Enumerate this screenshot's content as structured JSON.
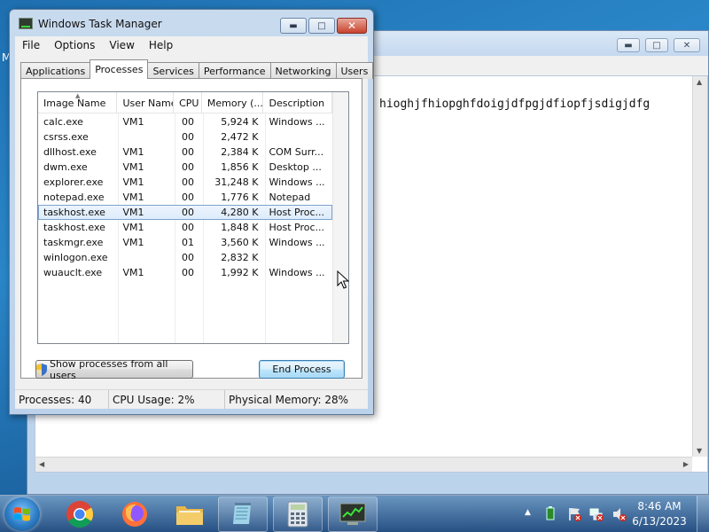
{
  "desktop": {
    "edge_letter": "M"
  },
  "notepad": {
    "text": "hioghjfhiopghfdoigjdfpgjdfiopfjsdigjdfg"
  },
  "taskmanager": {
    "title": "Windows Task Manager",
    "menu": [
      "File",
      "Options",
      "View",
      "Help"
    ],
    "tabs": [
      "Applications",
      "Processes",
      "Services",
      "Performance",
      "Networking",
      "Users"
    ],
    "active_tab": "Processes",
    "columns": [
      "Image Name",
      "User Name",
      "CPU",
      "Memory (...",
      "Description"
    ],
    "processes": [
      {
        "image": "calc.exe",
        "user": "VM1",
        "cpu": "00",
        "memory": "5,924 K",
        "desc": "Windows ..."
      },
      {
        "image": "csrss.exe",
        "user": "",
        "cpu": "00",
        "memory": "2,472 K",
        "desc": ""
      },
      {
        "image": "dllhost.exe",
        "user": "VM1",
        "cpu": "00",
        "memory": "2,384 K",
        "desc": "COM Surr..."
      },
      {
        "image": "dwm.exe",
        "user": "VM1",
        "cpu": "00",
        "memory": "1,856 K",
        "desc": "Desktop ..."
      },
      {
        "image": "explorer.exe",
        "user": "VM1",
        "cpu": "00",
        "memory": "31,248 K",
        "desc": "Windows ..."
      },
      {
        "image": "notepad.exe",
        "user": "VM1",
        "cpu": "00",
        "memory": "1,776 K",
        "desc": "Notepad"
      },
      {
        "image": "taskhost.exe",
        "user": "VM1",
        "cpu": "00",
        "memory": "4,280 K",
        "desc": "Host Proc..."
      },
      {
        "image": "taskhost.exe",
        "user": "VM1",
        "cpu": "00",
        "memory": "1,848 K",
        "desc": "Host Proc..."
      },
      {
        "image": "taskmgr.exe",
        "user": "VM1",
        "cpu": "01",
        "memory": "3,560 K",
        "desc": "Windows ..."
      },
      {
        "image": "winlogon.exe",
        "user": "",
        "cpu": "00",
        "memory": "2,832 K",
        "desc": ""
      },
      {
        "image": "wuauclt.exe",
        "user": "VM1",
        "cpu": "00",
        "memory": "1,992 K",
        "desc": "Windows ..."
      }
    ],
    "selected_row": 6,
    "show_all_label": "Show processes from all users",
    "end_process_label": "End Process",
    "status": {
      "processes": "Processes: 40",
      "cpu": "CPU Usage: 2%",
      "memory": "Physical Memory: 28%"
    }
  },
  "taskbar": {
    "pinned": [
      "windows-start",
      "chrome",
      "firefox",
      "file-explorer",
      "notepad",
      "calculator",
      "task-manager"
    ],
    "clock_time": "8:46 AM",
    "clock_date": "6/13/2023"
  },
  "colors": {
    "desktop_blue": "#1e6fb0",
    "window_frame": "#bcd1ea",
    "close_red": "#c8432d",
    "selection": "#dcebfc"
  }
}
